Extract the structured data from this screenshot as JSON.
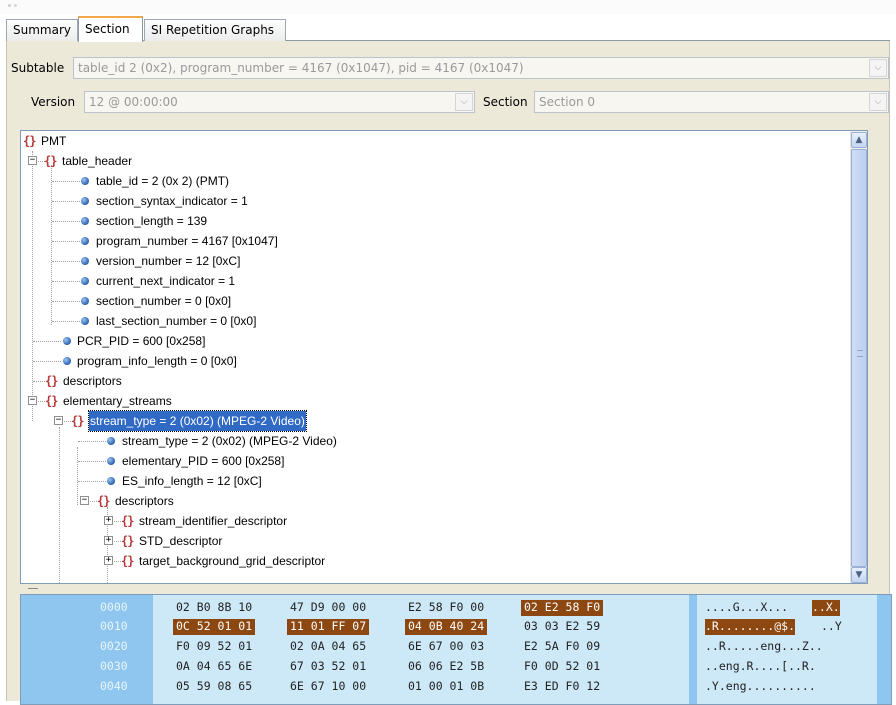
{
  "tabs": [
    {
      "label": "Summary"
    },
    {
      "label": "Section"
    },
    {
      "label": "SI Repetition Graphs"
    }
  ],
  "subtable": {
    "label": "Subtable",
    "value": "table_id 2 (0x2), program_number = 4167 (0x1047), pid = 4167 (0x1047)"
  },
  "version": {
    "label": "Version",
    "value": "12 @ 00:00:00"
  },
  "section": {
    "label": "Section",
    "value": "Section 0"
  },
  "icons": {
    "object": "brace-icon",
    "field": "blue-dot-icon",
    "expand": "plus-box",
    "collapse": "minus-box"
  },
  "tree": [
    {
      "text": "PMT"
    },
    {
      "text": "table_header"
    },
    {
      "text": "table_id = 2 (0x 2) (PMT)"
    },
    {
      "text": "section_syntax_indicator = 1"
    },
    {
      "text": "section_length = 139"
    },
    {
      "text": "program_number = 4167 [0x1047]"
    },
    {
      "text": "version_number = 12 [0xC]"
    },
    {
      "text": "current_next_indicator = 1"
    },
    {
      "text": "section_number = 0 [0x0]"
    },
    {
      "text": "last_section_number = 0 [0x0]"
    },
    {
      "text": "PCR_PID = 600 [0x258]"
    },
    {
      "text": "program_info_length = 0 [0x0]"
    },
    {
      "text": "descriptors"
    },
    {
      "text": "elementary_streams"
    },
    {
      "text": "stream_type = 2 (0x02) (MPEG-2 Video)"
    },
    {
      "text": "stream_type = 2 (0x02) (MPEG-2 Video)"
    },
    {
      "text": "elementary_PID = 600 [0x258]"
    },
    {
      "text": "ES_info_length = 12 [0xC]"
    },
    {
      "text": "descriptors"
    },
    {
      "text": "stream_identifier_descriptor"
    },
    {
      "text": "STD_descriptor"
    },
    {
      "text": "target_background_grid_descriptor"
    }
  ],
  "hex": [
    {
      "offset": "0000",
      "groups": [
        "02 B0 8B 10",
        "47 D9 00 00",
        "E2 58 F0 00",
        "02 E2 58 F0"
      ],
      "ascii": [
        {
          "t": "....G...X..."
        },
        {
          "t": "..X."
        }
      ]
    },
    {
      "offset": "0010",
      "groups": [
        "0C 52 01 01",
        "11 01 FF 07",
        "04 0B 40 24",
        "03 03 E2 59"
      ],
      "ascii": [
        {
          "t": ".R........@$."
        },
        {
          "t": "..Y"
        }
      ]
    },
    {
      "offset": "0020",
      "groups": [
        "F0 09 52 01",
        "02 0A 04 65",
        "6E 67 00 03",
        "E2 5A F0 09"
      ],
      "ascii": [
        {
          "t": "..R.....eng...Z.."
        }
      ]
    },
    {
      "offset": "0030",
      "groups": [
        "0A 04 65 6E",
        "67 03 52 01",
        "06 06 E2 5B",
        "F0 0D 52 01"
      ],
      "ascii": [
        {
          "t": "..eng.R....[..R."
        }
      ]
    },
    {
      "offset": "0040",
      "groups": [
        "05 59 08 65",
        "6E 67 10 00",
        "01 00 01 0B",
        "E3 ED F0 12"
      ],
      "ascii": [
        {
          "t": ".Y.eng.........."
        }
      ]
    }
  ]
}
